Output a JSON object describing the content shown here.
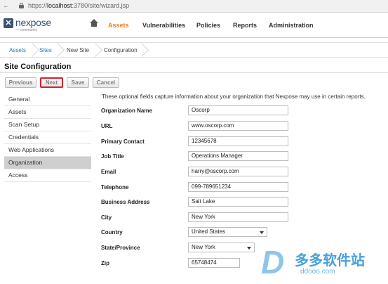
{
  "browser": {
    "url_prefix": "https://",
    "url_host": "localhost",
    "url_rest": ":3780/site/wizard.jsp"
  },
  "app": {
    "logo_text": "nexpose",
    "logo_sub": "community",
    "nav": [
      "Assets",
      "Vulnerabilities",
      "Policies",
      "Reports",
      "Administration"
    ],
    "active_nav": "Assets"
  },
  "breadcrumb": [
    "Assets",
    "Sites",
    "New Site",
    "Configuration"
  ],
  "page_title": "Site Configuration",
  "buttons": {
    "previous": "Previous",
    "next": "Next",
    "save": "Save",
    "cancel": "Cancel"
  },
  "menu": [
    "General",
    "Assets",
    "Scan Setup",
    "Credentials",
    "Web Applications",
    "Organization",
    "Access"
  ],
  "active_menu": "Organization",
  "form": {
    "intro": "These optional fields capture information about your organization that Nexpose may use in certain reports.",
    "fields": [
      {
        "label": "Organization Name",
        "value": "Oscorp"
      },
      {
        "label": "URL",
        "value": "www.oscorp.com"
      },
      {
        "label": "Primary Contact",
        "value": "12345678"
      },
      {
        "label": "Job Title",
        "value": "Operations Manager"
      },
      {
        "label": "Email",
        "value": "harry@oscorp.com"
      },
      {
        "label": "Telephone",
        "value": "099-789651234"
      },
      {
        "label": "Business Address",
        "value": "Salt Lake"
      },
      {
        "label": "City",
        "value": "New York"
      },
      {
        "label": "Country",
        "value": "United States"
      },
      {
        "label": "State/Province",
        "value": "New York"
      },
      {
        "label": "Zip",
        "value": "65748474"
      }
    ]
  },
  "watermark": {
    "letter": "D",
    "cn": "多多软件站",
    "en": "ddooo.com"
  },
  "colors": {
    "active_nav": "#f07c1a",
    "link": "#2f7dad",
    "highlight_border": "#d9202a",
    "logo": "#3a5374"
  }
}
